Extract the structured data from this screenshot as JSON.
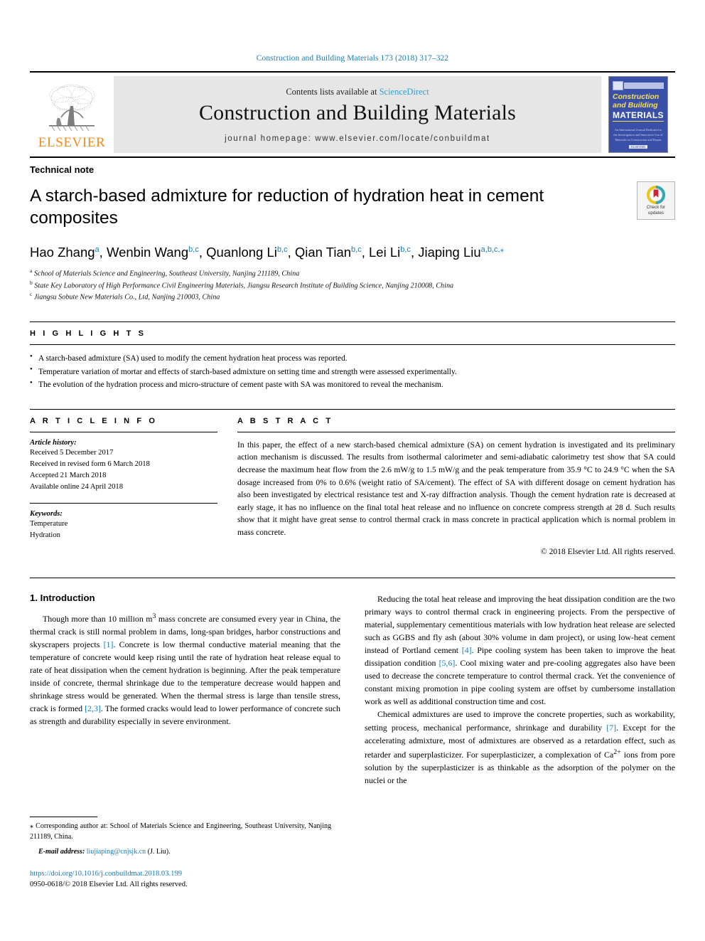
{
  "running_head": "Construction and Building Materials 173 (2018) 317–322",
  "masthead": {
    "publisher_name": "ELSEVIER",
    "contents_prefix": "Contents lists available at ",
    "contents_link": "ScienceDirect",
    "journal_title": "Construction and Building Materials",
    "homepage": "journal homepage: www.elsevier.com/locate/conbuildmat",
    "cover": {
      "line1": "Construction",
      "line2": "and Building",
      "line3": "MATERIALS",
      "subtitle": "An International Journal Dedicated to the Investigation and Innovative Use of Materials in Construction and Repair",
      "footer": "ELSEVIER"
    }
  },
  "article": {
    "kind": "Technical note",
    "title": "A starch-based admixture for reduction of hydration heat in cement composites",
    "crossmark_line1": "Check for",
    "crossmark_line2": "updates",
    "authors": [
      {
        "name": "Hao Zhang",
        "sup": "a",
        "sep": ", "
      },
      {
        "name": "Wenbin Wang",
        "sup": "b,c",
        "sep": ", "
      },
      {
        "name": "Quanlong Li",
        "sup": "b,c",
        "sep": ", "
      },
      {
        "name": "Qian Tian",
        "sup": "b,c",
        "sep": ", "
      },
      {
        "name": "Lei Li",
        "sup": "b,c",
        "sep": ", "
      },
      {
        "name": "Jiaping Liu",
        "sup": "a,b,c,*",
        "sep": ""
      }
    ],
    "affiliations": [
      {
        "marker": "a",
        "text": "School of Materials Science and Engineering, Southeast University, Nanjing 211189, China"
      },
      {
        "marker": "b",
        "text": "State Key Laboratory of High Performance Civil Engineering Materials, Jiangsu Research Institute of Building Science, Nanjing 210008, China"
      },
      {
        "marker": "c",
        "text": "Jiangsu Sobute New Materials Co., Ltd, Nanjing 210003, China"
      }
    ]
  },
  "highlights": {
    "label": "H I G H L I G H T S",
    "items": [
      "A starch-based admixture (SA) used to modify the cement hydration heat process was reported.",
      "Temperature variation of mortar and effects of starch-based admixture on setting time and strength were assessed experimentally.",
      "The evolution of the hydration process and micro-structure of cement paste with SA was monitored to reveal the mechanism."
    ]
  },
  "article_info": {
    "label": "A R T I C L E  I N F O",
    "history_label": "Article history:",
    "history": [
      "Received 5 December 2017",
      "Received in revised form 6 March 2018",
      "Accepted 21 March 2018",
      "Available online 24 April 2018"
    ],
    "keywords_label": "Keywords:",
    "keywords": [
      "Temperature",
      "Hydration"
    ]
  },
  "abstract": {
    "label": "A B S T R A C T",
    "text": "In this paper, the effect of a new starch-based chemical admixture (SA) on cement hydration is investigated and its preliminary action mechanism is discussed. The results from isothermal calorimeter and semi-adiabatic calorimetry test show that SA could decrease the maximum heat flow from the 2.6 mW/g to 1.5 mW/g and the peak temperature from 35.9 °C to 24.9 °C when the SA dosage increased from 0% to 0.6% (weight ratio of SA/cement). The effect of SA with different dosage on cement hydration has also been investigated by electrical resistance test and X-ray diffraction analysis. Though the cement hydration rate is decreased at early stage, it has no influence on the final total heat release and no influence on concrete compress strength at 28 d. Such results show that it might have great sense to control thermal crack in mass concrete in practical application which is normal problem in mass concrete.",
    "copyright": "© 2018 Elsevier Ltd. All rights reserved."
  },
  "body": {
    "section_title": "1. Introduction",
    "left_paragraphs": [
      "Though more than 10 million m³ mass concrete are consumed every year in China, the thermal crack is still normal problem in dams, long-span bridges, harbor constructions and skyscrapers projects [1]. Concrete is low thermal conductive material meaning that the temperature of concrete would keep rising until the rate of hydration heat release equal to rate of heat dissipation when the cement hydration is beginning. After the peak temperature inside of concrete, thermal shrinkage due to the temperature decrease would happen and shrinkage stress would be generated. When the thermal stress is large than tensile stress, crack is formed [2,3]. The formed cracks would lead to lower performance of concrete such as strength and durability especially in severe environment."
    ],
    "right_paragraphs": [
      "Reducing the total heat release and improving the heat dissipation condition are the two primary ways to control thermal crack in engineering projects. From the perspective of material, supplementary cementitious materials with low hydration heat release are selected such as GGBS and fly ash (about 30% volume in dam project), or using low-heat cement instead of Portland cement [4]. Pipe cooling system has been taken to improve the heat dissipation condition [5,6]. Cool mixing water and pre-cooling aggregates also have been used to decrease the concrete temperature to control thermal crack. Yet the convenience of constant mixing promotion in pipe cooling system are offset by cumbersome installation work as well as additional construction time and cost.",
      "Chemical admixtures are used to improve the concrete properties, such as workability, setting process, mechanical performance, shrinkage and durability [7]. Except for the accelerating admixture, most of admixtures are observed as a retardation effect, such as retarder and superplasticizer. For superplasticizer, a complexation of Ca²⁺ ions from pore solution by the superplasticizer is as thinkable as the adsorption of the polymer on the nuclei or the"
    ]
  },
  "footnote": {
    "corresponding": "⁎ Corresponding author at: School of Materials Science and Engineering, Southeast University, Nanjing 211189, China.",
    "email_label": "E-mail address:",
    "email": "liujiaping@cnjsjk.cn",
    "email_owner": "(J. Liu)."
  },
  "imprint": {
    "doi": "https://doi.org/10.1016/j.conbuildmat.2018.03.199",
    "issn": "0950-0618/© 2018 Elsevier Ltd. All rights reserved."
  },
  "colors": {
    "link": "#1a7bb9",
    "sciencedirect": "#2e9fd4",
    "elsevier_orange": "#f18b21",
    "masthead_bg": "#e6e6e6",
    "cover_blue": "#3a4fa8"
  }
}
